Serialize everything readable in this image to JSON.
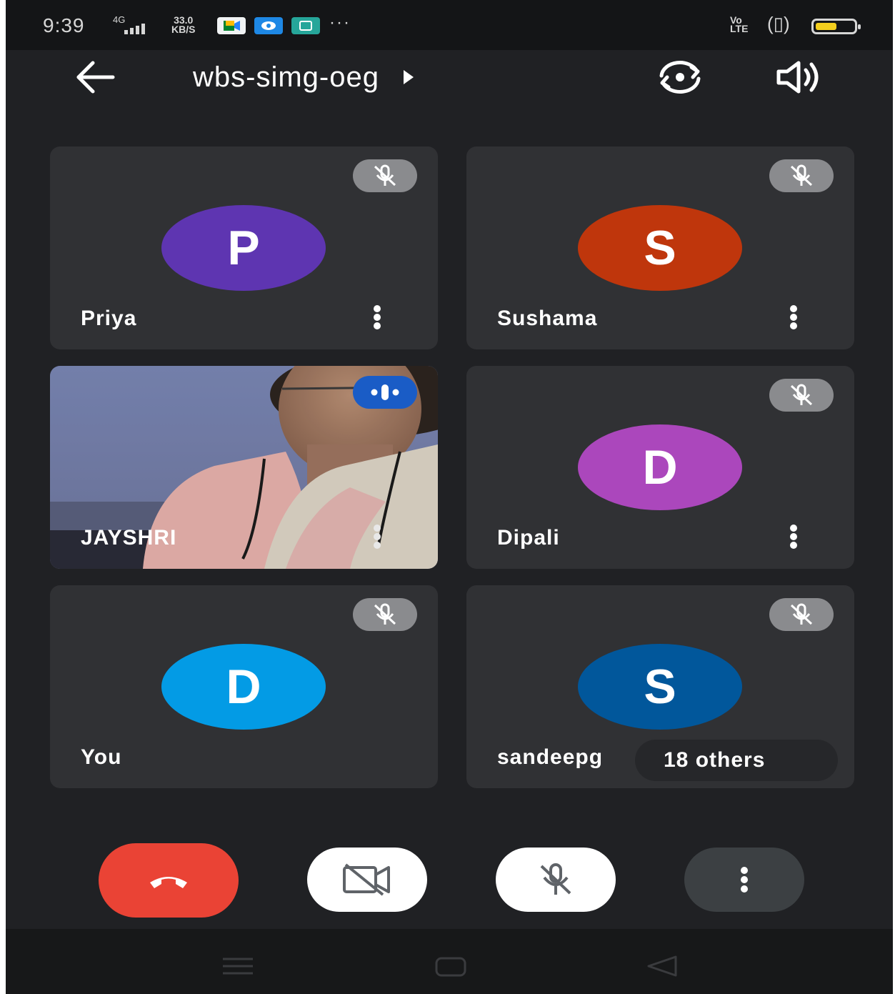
{
  "status_bar": {
    "time": "9:39",
    "network": "4G",
    "speed_value": "33.0",
    "speed_unit": "KB/S",
    "more": "···",
    "volte_top": "Vo",
    "volte_bottom": "LTE",
    "vibrate": "(▯)",
    "battery_level": 0.55,
    "battery_color": "#f4cf1e"
  },
  "header": {
    "meeting_code": "wbs-simg-oeg"
  },
  "participants": [
    {
      "name": "Priya",
      "initial": "P",
      "color": "#5e35b1",
      "muted": true
    },
    {
      "name": "Sushama",
      "initial": "S",
      "color": "#bf360c",
      "muted": true
    },
    {
      "name": "JAYSHRI",
      "video": true,
      "speaking": true
    },
    {
      "name": "Dipali",
      "initial": "D",
      "color": "#ab47bc",
      "muted": true
    },
    {
      "name": "You",
      "initial": "D",
      "color": "#039be5",
      "muted": true
    },
    {
      "name": "sandeepg",
      "initial": "S",
      "color": "#01579b",
      "muted": true,
      "others_label": "18 others"
    }
  ],
  "controls": {
    "end_call_color": "#ea4335"
  }
}
